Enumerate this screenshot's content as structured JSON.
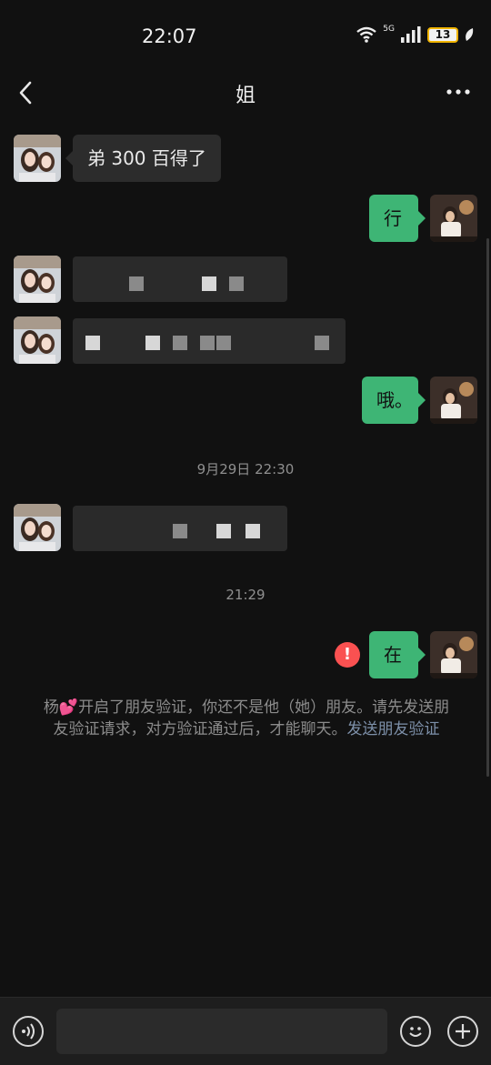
{
  "status": {
    "time": "22:07",
    "network": "5G",
    "battery": "13"
  },
  "header": {
    "title": "姐"
  },
  "messages": [
    {
      "side": "left",
      "text": "弟 300 百得了"
    },
    {
      "side": "right",
      "text": "行"
    },
    {
      "side": "right",
      "text": "哦。"
    },
    {
      "side": "right",
      "text": "在"
    }
  ],
  "timestamps": {
    "t1": "9月29日 22:30",
    "t2": "21:29"
  },
  "system_note": {
    "text": "杨💕开启了朋友验证，你还不是他（她）朋友。请先发送朋友验证请求，对方验证通过后，才能聊天。",
    "link": "发送朋友验证"
  },
  "colors": {
    "accent_green": "#3eb575",
    "error_red": "#fa5151",
    "link_blue": "#7d90a9"
  },
  "icons": [
    "back-icon",
    "more-icon",
    "voice-icon",
    "emoji-icon",
    "plus-icon",
    "error-icon"
  ]
}
